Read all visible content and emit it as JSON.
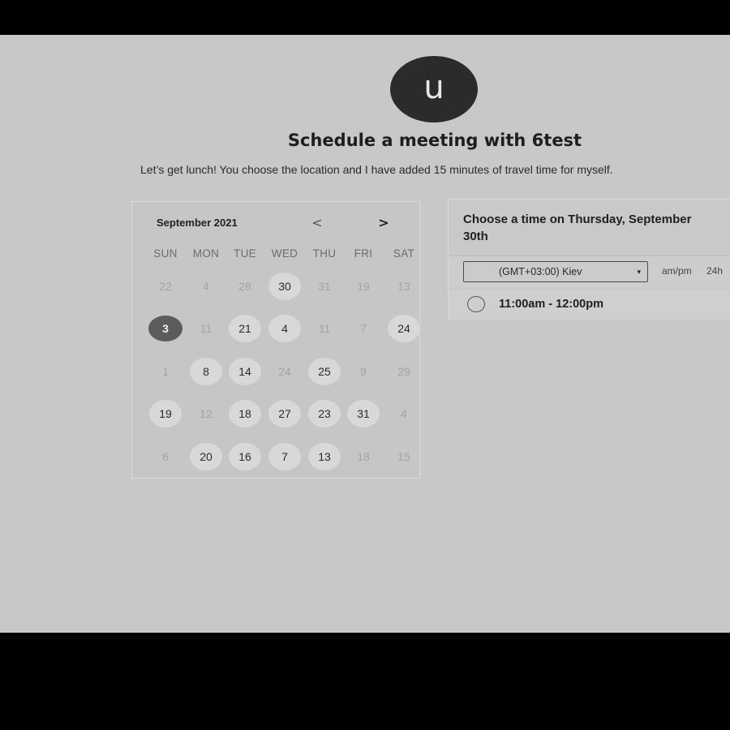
{
  "header": {
    "avatar_letter": "u",
    "title": "Schedule a meeting with 6test",
    "subtitle": "Let’s get lunch! You choose the location and I have added 15 minutes of travel time for myself."
  },
  "calendar": {
    "month_label": "September 2021",
    "prev_icon": "<",
    "next_icon": ">",
    "weekdays": [
      "SUN",
      "MON",
      "TUE",
      "WED",
      "THU",
      "FRI",
      "SAT"
    ],
    "weeks": [
      [
        {
          "d": "22",
          "s": "off"
        },
        {
          "d": "4",
          "s": "off"
        },
        {
          "d": "28",
          "s": "off"
        },
        {
          "d": "30",
          "s": "avail"
        },
        {
          "d": "31",
          "s": "off"
        },
        {
          "d": "19",
          "s": "off"
        },
        {
          "d": "13",
          "s": "off"
        }
      ],
      [
        {
          "d": "3",
          "s": "selected"
        },
        {
          "d": "11",
          "s": "off"
        },
        {
          "d": "21",
          "s": "avail"
        },
        {
          "d": "4",
          "s": "avail"
        },
        {
          "d": "11",
          "s": "off"
        },
        {
          "d": "7",
          "s": "off"
        },
        {
          "d": "24",
          "s": "avail"
        }
      ],
      [
        {
          "d": "1",
          "s": "off"
        },
        {
          "d": "8",
          "s": "avail"
        },
        {
          "d": "14",
          "s": "avail"
        },
        {
          "d": "24",
          "s": "off"
        },
        {
          "d": "25",
          "s": "avail"
        },
        {
          "d": "9",
          "s": "off"
        },
        {
          "d": "29",
          "s": "off"
        }
      ],
      [
        {
          "d": "19",
          "s": "avail"
        },
        {
          "d": "12",
          "s": "off"
        },
        {
          "d": "18",
          "s": "avail"
        },
        {
          "d": "27",
          "s": "avail"
        },
        {
          "d": "23",
          "s": "avail"
        },
        {
          "d": "31",
          "s": "avail"
        },
        {
          "d": "4",
          "s": "off"
        }
      ],
      [
        {
          "d": "6",
          "s": "off"
        },
        {
          "d": "20",
          "s": "avail"
        },
        {
          "d": "16",
          "s": "avail"
        },
        {
          "d": "7",
          "s": "avail"
        },
        {
          "d": "13",
          "s": "avail"
        },
        {
          "d": "18",
          "s": "off"
        },
        {
          "d": "15",
          "s": "off"
        }
      ]
    ]
  },
  "time_panel": {
    "title": "Choose a time on Thursday, September 30th",
    "timezone": "(GMT+03:00) Kiev",
    "timezone_caret": "▾",
    "format_ampm": "am/pm",
    "format_24h": "24h",
    "slots": [
      {
        "label": "11:00am - 12:00pm"
      }
    ]
  }
}
